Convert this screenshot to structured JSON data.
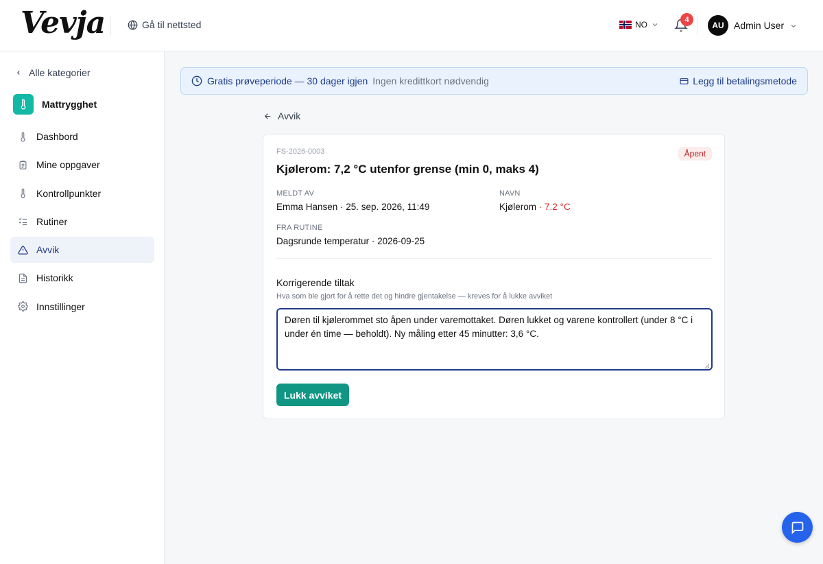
{
  "header": {
    "logo": "Vevja",
    "goto_site": "Gå til nettsted",
    "lang": "NO",
    "notification_count": "4",
    "user_initials": "AU",
    "user_name": "Admin User"
  },
  "sidebar": {
    "back_label": "Alle kategorier",
    "category_title": "Mattrygghet",
    "items": [
      {
        "label": "Dashbord",
        "icon": "thermometer-icon"
      },
      {
        "label": "Mine oppgaver",
        "icon": "clipboard-icon"
      },
      {
        "label": "Kontrollpunkter",
        "icon": "thermometer-icon"
      },
      {
        "label": "Rutiner",
        "icon": "checklist-icon"
      },
      {
        "label": "Avvik",
        "icon": "warning-icon",
        "active": true
      },
      {
        "label": "Historikk",
        "icon": "document-icon"
      },
      {
        "label": "Innstillinger",
        "icon": "gear-icon"
      }
    ]
  },
  "banner": {
    "title": "Gratis prøveperiode — 30 dager igjen",
    "subtitle": "Ingen kredittkort nødvendig",
    "action": "Legg til betalingsmetode"
  },
  "back_link": "Avvik",
  "deviation": {
    "ref": "FS-2026-0003",
    "status": "Åpent",
    "title": "Kjølerom: 7,2 °C utenfor grense (min 0, maks 4)",
    "reported_by_label": "MELDT AV",
    "reported_by_value": "Emma Hansen · 25. sep. 2026, 11:49",
    "name_label": "NAVN",
    "name_value": "Kjølerom",
    "name_temp": "· 7.2 °C",
    "routine_label": "FRA RUTINE",
    "routine_value": "Dagsrunde temperatur · 2026-09-25",
    "corrective_label": "Korrigerende tiltak",
    "corrective_help": "Hva som ble gjort for å rette det og hindre gjentakelse — kreves for å lukke avviket",
    "corrective_text": "Døren til kjølerommet sto åpen under varemottaket. Døren lukket og varene kontrollert (under 8 °C i under én time — beholdt). Ny måling etter 45 minutter: 3,6 °C.",
    "close_button": "Lukk avviket"
  },
  "colors": {
    "primary": "#1e3a8a",
    "accent_teal": "#14b8a6",
    "button_teal": "#119684",
    "danger": "#dc2626",
    "chat_blue": "#2563eb"
  }
}
